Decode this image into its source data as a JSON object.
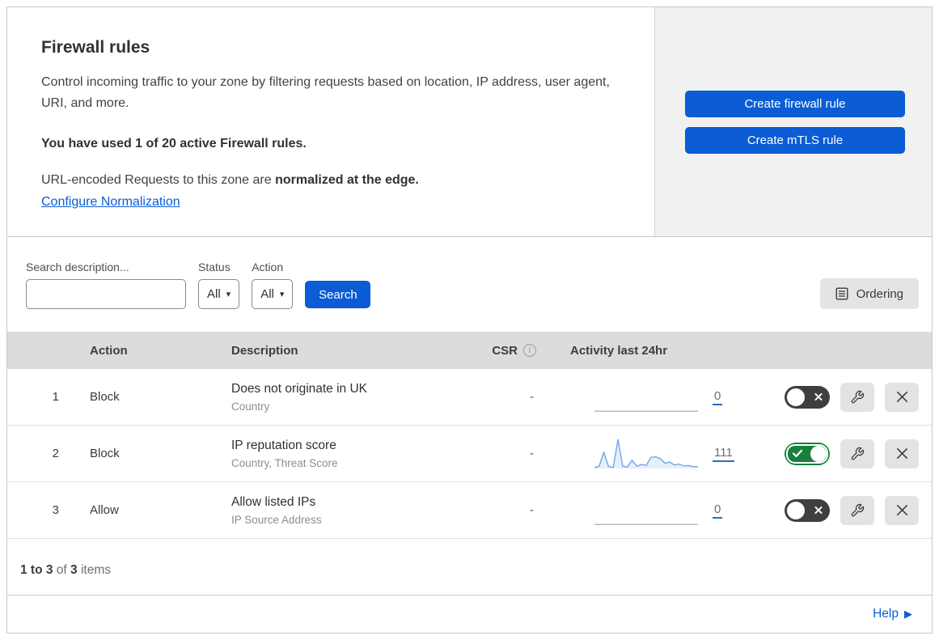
{
  "header": {
    "title": "Firewall rules",
    "description": "Control incoming traffic to your zone by filtering requests based on location, IP address, user agent, URI, and more.",
    "usage_line": "You have used 1 of 20 active Firewall rules.",
    "normalization_text": "URL-encoded Requests to this zone are ",
    "normalization_bold": "normalized at the edge.",
    "normalization_link": "Configure Normalization",
    "create_firewall_button": "Create firewall rule",
    "create_mtls_button": "Create mTLS rule"
  },
  "filters": {
    "search_label": "Search description...",
    "search_value": "",
    "status_label": "Status",
    "status_value": "All",
    "action_label": "Action",
    "action_value": "All",
    "search_button": "Search",
    "ordering_button": "Ordering"
  },
  "table": {
    "columns": {
      "action": "Action",
      "description": "Description",
      "csr": "CSR",
      "activity": "Activity last 24hr"
    },
    "rows": [
      {
        "index": "1",
        "action": "Block",
        "description": "Does not originate in UK",
        "criteria": "Country",
        "csr": "-",
        "activity_count": "0",
        "enabled": false,
        "sparkline": {
          "color": "#b9b9b9",
          "fill": "none",
          "points": [
            2,
            2
          ]
        }
      },
      {
        "index": "2",
        "action": "Block",
        "description": "IP reputation score",
        "criteria": "Country, Threat Score",
        "csr": "-",
        "activity_count": "111",
        "enabled": true,
        "sparkline": {
          "color": "#7aa9e9",
          "fill": "rgba(122,169,233,0.18)",
          "points": [
            3,
            8,
            55,
            6,
            4,
            100,
            8,
            5,
            28,
            8,
            14,
            10,
            38,
            40,
            34,
            18,
            22,
            12,
            15,
            9,
            10,
            6,
            6
          ]
        }
      },
      {
        "index": "3",
        "action": "Allow",
        "description": "Allow listed IPs",
        "criteria": "IP Source Address",
        "csr": "-",
        "activity_count": "0",
        "enabled": false,
        "sparkline": {
          "color": "#b9b9b9",
          "fill": "none",
          "points": [
            2,
            2
          ]
        }
      }
    ]
  },
  "footer": {
    "range_bold": "1 to 3",
    "of_text": " of ",
    "total_bold": "3",
    "items_text": " items",
    "help_label": "Help"
  },
  "icons": {
    "info_i": "i",
    "dropdown_caret": "▾",
    "help_arrow": "▶",
    "search": "magnifier-glyph",
    "ordering": "list-document-glyph",
    "wrench": "wrench-glyph",
    "close": "x-glyph",
    "toggle_on": "check-glyph",
    "toggle_off": "x-glyph"
  },
  "colors": {
    "primary_blue": "#0b5cd5",
    "link_blue": "#0b5cd5",
    "toggle_on_green": "#17803d",
    "toggle_off_gray": "#3f3f3f",
    "sparkline_blue": "#7aa9e9",
    "panel_gray": "#f1f1f1",
    "table_header_gray": "#dcdcdc"
  }
}
